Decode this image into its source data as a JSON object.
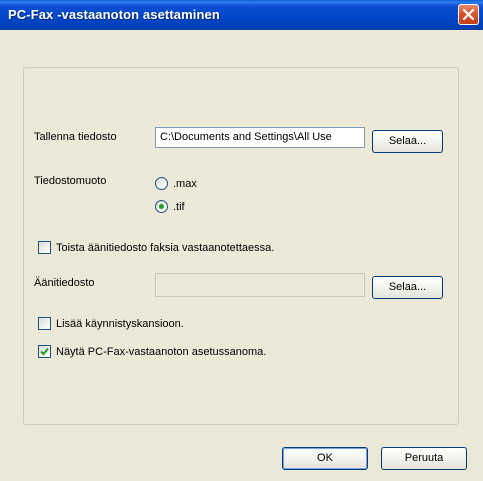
{
  "window": {
    "title": "PC-Fax -vastaanoton asettaminen",
    "close_icon": "close-icon"
  },
  "form": {
    "save_file_label": "Tallenna tiedosto",
    "save_file_path": "C:\\Documents and Settings\\All Use",
    "browse_label_1": "Selaa...",
    "file_format_label": "Tiedostomuoto",
    "format_options": [
      {
        "label": ".max",
        "selected": false
      },
      {
        "label": ".tif",
        "selected": true
      }
    ],
    "play_sound_label": "Toista äänitiedosto faksia vastaanotettaessa.",
    "play_sound_checked": false,
    "sound_file_label": "Äänitiedosto",
    "sound_file_path": "",
    "browse_label_2": "Selaa...",
    "startup_label": "Lisää käynnistyskansioon.",
    "startup_checked": false,
    "show_message_label": "Näytä PC-Fax-vastaanoton asetussanoma.",
    "show_message_checked": true
  },
  "buttons": {
    "ok_label": "OK",
    "cancel_label": "Peruuta"
  },
  "colors": {
    "title_bar": "#0046c8",
    "dialog_bg": "#ece9d8",
    "close_button": "#d8542e",
    "radio_dot": "#21a121",
    "checkmark": "#21a121"
  }
}
